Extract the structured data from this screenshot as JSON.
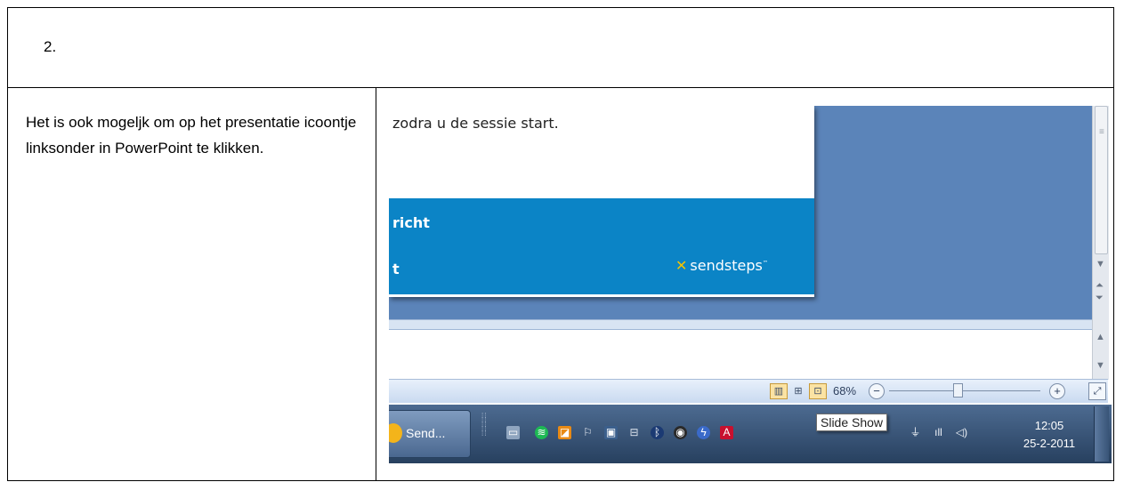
{
  "step_number": "2.",
  "instruction": "Het is ook mogeljk om op het presentatie icoontje linksonder in PowerPoint te klikken.",
  "slide": {
    "text_line": "zodra u de sessie start.",
    "band_line_1": "richt",
    "band_line_2": "t",
    "logo_text": "sendsteps"
  },
  "statusbar": {
    "view_buttons": [
      "normal-view-icon",
      "slide-sorter-icon",
      "slide-show-icon"
    ],
    "zoom": "68%",
    "zoom_minus": "−",
    "zoom_plus": "+"
  },
  "taskbar": {
    "task_label": "Send...",
    "tooltip": "Slide Show",
    "time": "12:05",
    "date": "25-2-2011"
  },
  "colors": {
    "slide_band": "#0b84c6",
    "workspace": "#5b84b9",
    "taskbar": "#27405f"
  }
}
